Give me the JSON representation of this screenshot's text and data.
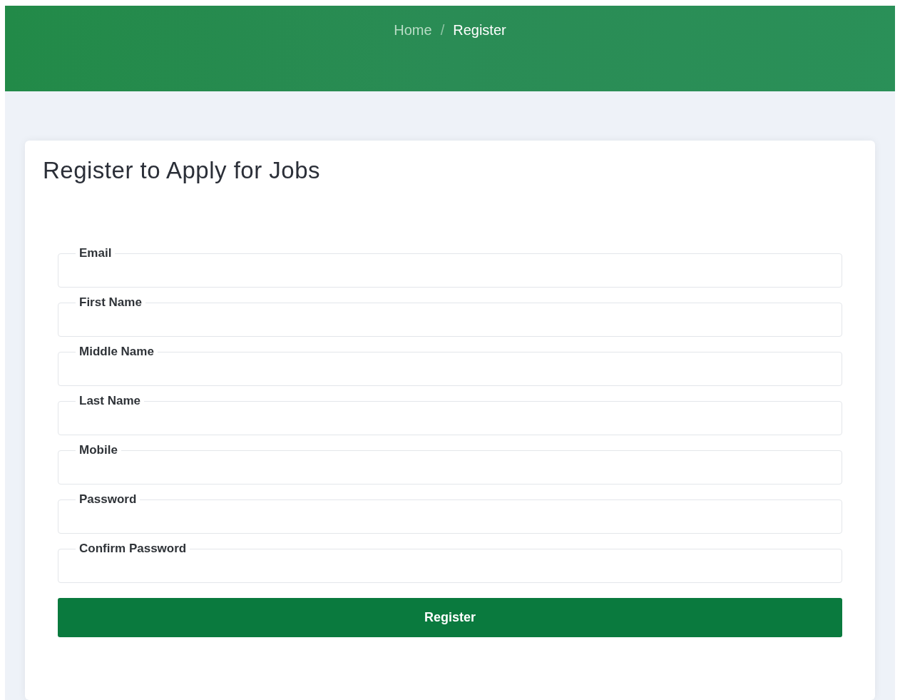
{
  "breadcrumb": [
    {
      "label": "Home",
      "selected": false
    },
    {
      "label": "Register",
      "selected": true
    }
  ],
  "breadcrumb_separator": "/",
  "form": {
    "title": "Register to Apply for Jobs",
    "fields": [
      {
        "label": "Email"
      },
      {
        "label": "First Name"
      },
      {
        "label": "Middle Name"
      },
      {
        "label": "Last Name"
      },
      {
        "label": "Mobile"
      },
      {
        "label": "Password"
      },
      {
        "label": "Confirm Password"
      }
    ],
    "submit": "Register"
  }
}
